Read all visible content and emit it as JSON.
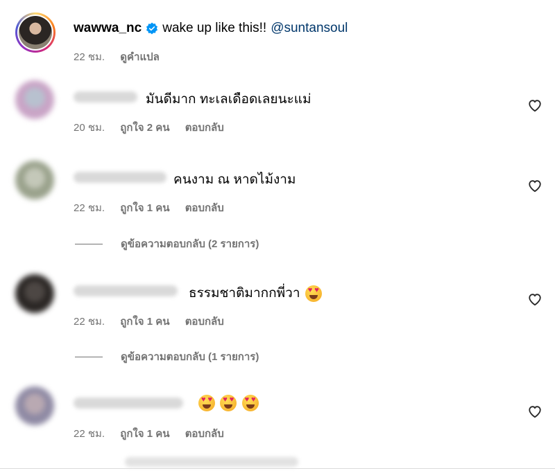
{
  "caption": {
    "username": "wawwa_nc",
    "text": "wake up like this!!",
    "mention": "@suntansoul",
    "time": "22 ชม.",
    "translate": "ดูคำแปล"
  },
  "comments": [
    {
      "text": "มันดีมาก ทะเลเดือดเลยนะแม่",
      "time": "20 ชม.",
      "likes": "ถูกใจ 2 คน",
      "reply": "ตอบกลับ",
      "avatar_color": "#c9a4c6"
    },
    {
      "text": "คนงาม ณ หาดไม้งาม",
      "time": "22 ชม.",
      "likes": "ถูกใจ 1 คน",
      "reply": "ตอบกลับ",
      "avatar_color": "#9aa28c",
      "view_replies": "ดูข้อความตอบกลับ (2 รายการ)"
    },
    {
      "text": "ธรรมชาติมากกพี่วา",
      "time": "22 ชม.",
      "likes": "ถูกใจ 1 คน",
      "reply": "ตอบกลับ",
      "avatar_color": "#3a3533",
      "view_replies": "ดูข้อความตอบกลับ (1 รายการ)"
    },
    {
      "text": "",
      "time": "22 ชม.",
      "likes": "ถูกใจ 1 คน",
      "reply": "ตอบกลับ",
      "avatar_color": "#8f8aa4"
    }
  ],
  "colors": {
    "link": "#00376b",
    "muted": "#737373",
    "verified": "#0095f6"
  }
}
